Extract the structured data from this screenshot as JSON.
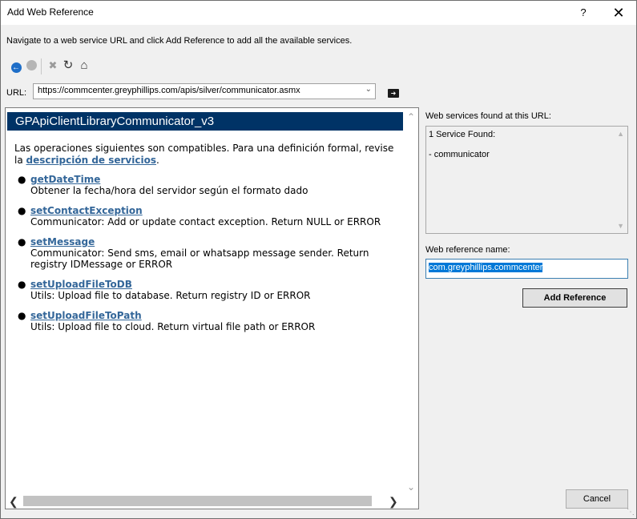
{
  "window": {
    "title": "Add Web Reference",
    "help_label": "?",
    "close_label": "✕"
  },
  "instructions": "Navigate to a web service URL and click Add Reference to add all the available services.",
  "toolbar": {
    "back_icon": "back-icon",
    "forward_icon": "forward-icon",
    "stop_icon": "stop-icon",
    "refresh_icon": "refresh-icon",
    "home_icon": "home-icon"
  },
  "url": {
    "label": "URL:",
    "value": "https://commcenter.greyphillips.com/apis/silver/communicator.asmx",
    "go_icon": "go-arrow-icon"
  },
  "browser": {
    "service_title": "GPApiClientLibraryCommunicator_v3",
    "intro_text": "Las operaciones siguientes son compatibles. Para una definición formal, revise la",
    "intro_link": "descripción de servicios",
    "intro_end": ".",
    "operations": [
      {
        "name": "getDateTime",
        "description": "Obtener la fecha/hora del servidor según el formato dado"
      },
      {
        "name": "setContactException",
        "description": "Communicator: Add or update contact exception. Return NULL or ERROR"
      },
      {
        "name": "setMessage",
        "description": "Communicator: Send sms, email or whatsapp message sender. Return registry IDMessage or ERROR"
      },
      {
        "name": "setUploadFileToDB",
        "description": "Utils: Upload file to database. Return registry ID or ERROR"
      },
      {
        "name": "setUploadFileToPath",
        "description": "Utils: Upload file to cloud. Return virtual file path or ERROR"
      }
    ]
  },
  "services": {
    "label": "Web services found at this URL:",
    "count_text": "1 Service Found:",
    "items": [
      "- communicator"
    ]
  },
  "reference": {
    "label": "Web reference name:",
    "value": "com.greyphillips.commcenter"
  },
  "buttons": {
    "add_reference": "Add Reference",
    "cancel": "Cancel"
  }
}
